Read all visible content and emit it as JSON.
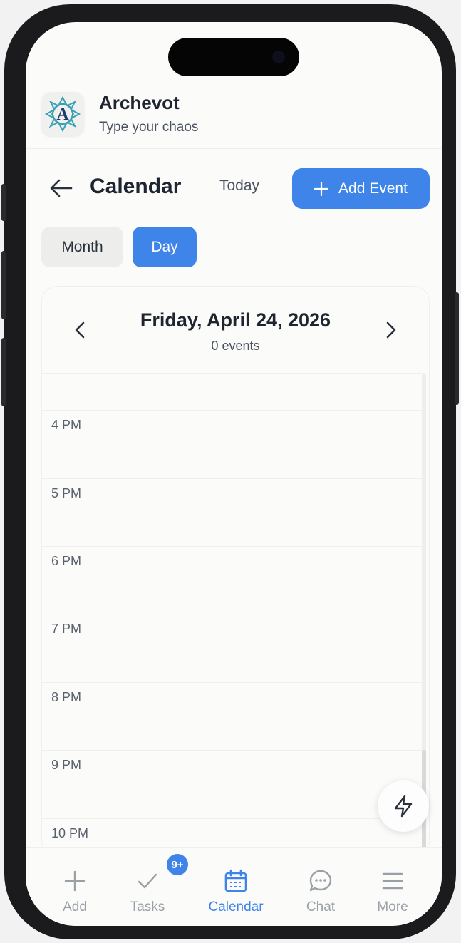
{
  "app": {
    "title": "Archevot",
    "subtitle": "Type your chaos",
    "accent_color": "#3f84e8"
  },
  "header": {
    "title": "Calendar",
    "today_label": "Today",
    "add_event_label": "Add Event"
  },
  "view_toggle": {
    "options": [
      "Month",
      "Day"
    ],
    "selected": "Day"
  },
  "day_view": {
    "date_title": "Friday, April 24, 2026",
    "event_count": "0 events",
    "hours": [
      "4 PM",
      "5 PM",
      "6 PM",
      "7 PM",
      "8 PM",
      "9 PM",
      "10 PM"
    ]
  },
  "bottom_nav": {
    "items": [
      {
        "label": "Add",
        "icon": "plus-icon"
      },
      {
        "label": "Tasks",
        "icon": "check-icon",
        "badge": "9+"
      },
      {
        "label": "Calendar",
        "icon": "calendar-icon",
        "active": true
      },
      {
        "label": "Chat",
        "icon": "chat-bubble-icon"
      },
      {
        "label": "More",
        "icon": "menu-icon"
      }
    ]
  }
}
